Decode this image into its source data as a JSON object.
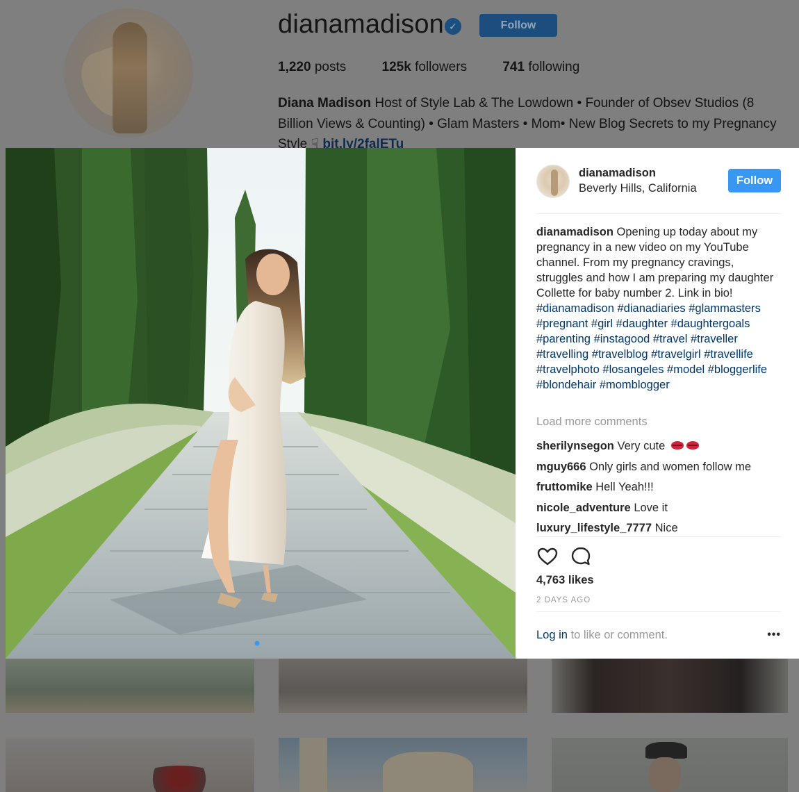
{
  "profile": {
    "username": "dianamadison",
    "verified_glyph": "✓",
    "follow_label": "Follow",
    "stats": [
      {
        "value": "1,220",
        "label": "posts"
      },
      {
        "value": "125k",
        "label": "followers"
      },
      {
        "value": "741",
        "label": "following"
      }
    ],
    "bio_name": "Diana Madison",
    "bio_text": "Host of Style Lab & The Lowdown • Founder of Obsev Studios (8 Billion Views & Counting) • Glam Masters • Mom• New Blog Secrets to my Pregnancy Style",
    "bio_link": "bit.ly/2falETu"
  },
  "post": {
    "username": "dianamadison",
    "location": "Beverly Hills, California",
    "follow_label": "Follow",
    "caption_text": "Opening up today about my pregnancy in a new video on my YouTube channel. From my pregnancy cravings, struggles and how I am preparing my daughter Collette for baby number 2. Link in bio!",
    "hashtags": "#dianamadison #dianadiaries #glammasters #pregnant #girl #daughter #daughtergoals #parenting #instagood #travel #traveller #travelling #travelblog #travelgirl #travellife #travelphoto #losangeles #model #bloggerlife #blondehair #momblogger",
    "load_more": "Load more comments",
    "comments": [
      {
        "user": "sherilynsegon",
        "text": "Very cute"
      },
      {
        "user": "mguy666",
        "text": "Only girls and women follow me"
      },
      {
        "user": "fruttomike",
        "text": "Hell Yeah!!!"
      },
      {
        "user": "nicole_adventure",
        "text": "Love it"
      },
      {
        "user": "luxury_lifestyle_7777",
        "text": "Nice"
      }
    ],
    "likes": "4,763 likes",
    "timestamp": "2 DAYS AGO",
    "login_link": "Log in",
    "login_suffix": "to like or comment.",
    "more_glyph": "•••"
  },
  "colors": {
    "follow_blue": "#3897f0",
    "hashtag": "#003569",
    "muted": "#999999",
    "overlay": "#7f7f7f"
  }
}
